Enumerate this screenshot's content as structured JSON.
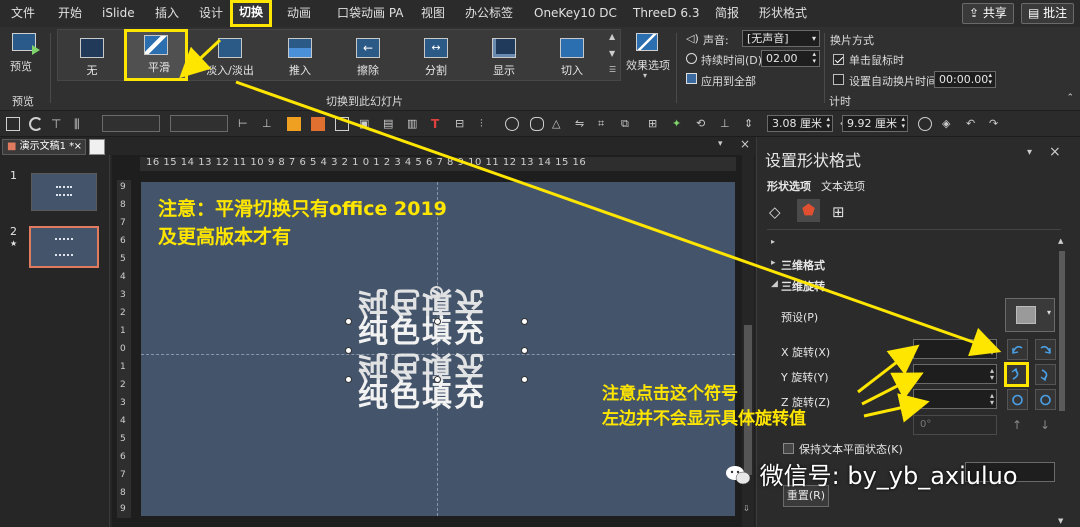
{
  "menu": {
    "tabs": [
      "文件",
      "开始",
      "iSlide",
      "插入",
      "设计",
      "切换",
      "动画",
      "口袋动画 PA",
      "视图",
      "办公标签",
      "OneKey10 DC",
      "ThreeD 6.3",
      "简报",
      "形状格式"
    ],
    "active_tab": "切换",
    "share_label": "共享",
    "comments_label": "批注"
  },
  "ribbon": {
    "preview_label": "预览",
    "preview_group_label": "预览",
    "transitions": [
      "无",
      "平滑",
      "淡入/淡出",
      "推入",
      "擦除",
      "分割",
      "显示",
      "切入"
    ],
    "selected_transition": "平滑",
    "effect_options_label": "效果选项",
    "group_label": "切换到此幻灯片",
    "sound_label": "声音:",
    "sound_value": "[无声音]",
    "duration_label": "持续时间(D):",
    "duration_value": "02.00",
    "apply_all_label": "应用到全部",
    "advance_label": "换片方式",
    "on_click_label": "单击鼠标时",
    "after_label": "设置自动换片时间:",
    "after_value": "00:00.00",
    "timing_group_label": "计时"
  },
  "format_toolbar": {
    "width_value": "3.08 厘米",
    "height_value": "9.92 厘米"
  },
  "document": {
    "tab_title": "演示文稿1 *",
    "slide_numbers": [
      "1",
      "2"
    ],
    "ruler_h": "16 15 14 13 12 11 10 9 8 7 6 5 4 3 2 1 0 1 2 3 4 5 6 7 8 9 10 11 12 13 14 15 16",
    "ruler_v": [
      "9",
      "8",
      "7",
      "6",
      "5",
      "4",
      "3",
      "2",
      "1",
      "0",
      "1",
      "2",
      "3",
      "4",
      "5",
      "6",
      "7",
      "8",
      "9"
    ]
  },
  "slide": {
    "note_line1": "注意：平滑切换只有office 2019",
    "note_line2": "及更高版本才有",
    "shape_text_lines": [
      "纯色填充",
      "纯色填充",
      "纯色填充",
      "纯色填充"
    ]
  },
  "panel": {
    "title": "设置形状格式",
    "tab_shape": "形状选项",
    "tab_text": "文本选项",
    "section_3d_format": "三维格式",
    "section_3d_rotation": "三维旋转",
    "preset_label": "预设(P)",
    "x_rotation_label": "X 旋转(X)",
    "y_rotation_label": "Y 旋转(Y)",
    "z_rotation_label": "Z 旋转(Z)",
    "perspective_value": "0°",
    "keep_text_flat_label": "保持文本平面状态(K)",
    "reset_label": "重置(R)"
  },
  "annotations": {
    "line1": "注意点击这个符号",
    "line2": "左边并不会显示具体旋转值"
  },
  "watermark": "微信号: by_yb_axiuluo",
  "colors": {
    "highlight": "#ffe600",
    "slide_bg": "#44546a",
    "app_bg": "#2b2b2b",
    "accent": "#e07b5f"
  }
}
